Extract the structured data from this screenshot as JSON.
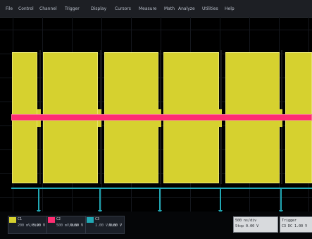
{
  "menubar": {
    "items": [
      "File",
      "Control",
      "Channel",
      "Trigger",
      "Display",
      "Cursors",
      "Measure",
      "Math",
      "Analyze",
      "Utilities",
      "Help"
    ]
  },
  "channels": [
    {
      "label": "C1",
      "sublabel": "200 mV/div",
      "value": "0.00 V",
      "color": "#d6d12f"
    },
    {
      "label": "C2",
      "sublabel": "500 mV/div",
      "value": "0.00 V",
      "color": "#ff2d72"
    },
    {
      "label": "C3",
      "sublabel": "1.00 V/div",
      "value": "0.00 V",
      "color": "#21a8b4"
    }
  ],
  "timebase": {
    "line1": "500 ns/div",
    "line2": "Stop   0.00 V"
  },
  "trigger": {
    "line1": "Trigger",
    "line2": "C3 DC  1.00 V"
  }
}
